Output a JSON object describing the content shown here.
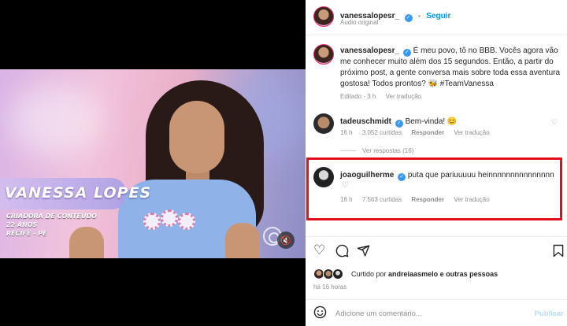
{
  "video": {
    "name_overlay": "VANESSA LOPES",
    "info": [
      "CRIADORA DE CONTEÚDO",
      "22 ANOS",
      "RECIFE - PE"
    ],
    "mute_icon": "speaker-muted-icon"
  },
  "post": {
    "username": "vanessalopesr_",
    "follow_label": "Seguir",
    "audio": "Áudio original",
    "caption_user": "vanessalopesr_",
    "caption": "É meu povo, tô no BBB. Vocês agora vão me conhecer muito além dos 15 segundos. Então, a partir do próximo post, a gente conversa mais sobre toda essa aventura gostosa! Todos prontos? 🐝 #TeamVanessa",
    "caption_meta": [
      "Editado · 3 h",
      "Ver tradução"
    ]
  },
  "comments": [
    {
      "username": "tadeuschmidt",
      "text": "Bem-vinda! 😊",
      "meta": [
        "16 h",
        "3.052 curtidas",
        "Responder",
        "Ver tradução"
      ],
      "replies": "Ver respostas (16)"
    },
    {
      "username": "joaoguilherme",
      "text": "puta que pariuuuuu heinnnnnnnnnnnnnnn",
      "meta": [
        "16 h",
        "7.563 curtidas",
        "Responder",
        "Ver tradução"
      ]
    }
  ],
  "footer": {
    "liked_prefix": "Curtido por",
    "liked_user": "andreiaasmelo",
    "liked_suffix": "e outras pessoas",
    "time_ago": "há 16 horas",
    "comment_placeholder": "Adicione um comentário...",
    "publish_label": "Publicar"
  },
  "colors": {
    "link_blue": "#0095f6",
    "highlight_red": "#e10f19"
  }
}
